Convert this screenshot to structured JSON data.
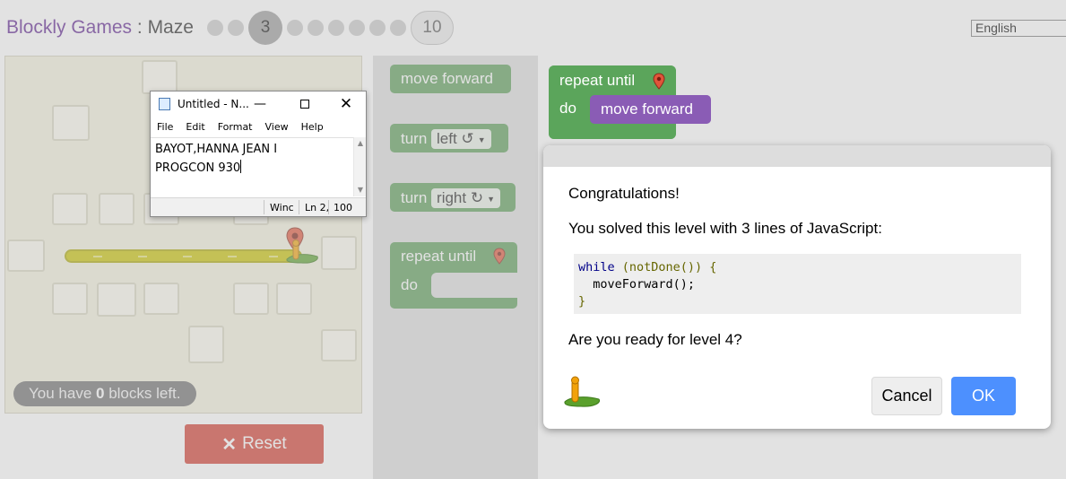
{
  "header": {
    "brand": "Blockly Games",
    "separator": " : ",
    "game": "Maze",
    "current_level": "3",
    "last_level": "10",
    "language": "English"
  },
  "maze": {
    "blocks_left_prefix": "You have ",
    "blocks_left_count": "0",
    "blocks_left_suffix": " blocks left.",
    "reset_label": "Reset",
    "reset_icon": "close-x-icon"
  },
  "toolbox": {
    "move_forward": "move forward",
    "turn_left_prefix": "turn",
    "turn_left_value": "left ↺",
    "turn_right_prefix": "turn",
    "turn_right_value": "right ↻",
    "repeat_until": "repeat until",
    "do": "do"
  },
  "workspace": {
    "repeat_until": "repeat until",
    "do": "do",
    "move_forward": "move forward"
  },
  "dialog": {
    "congrats": "Congratulations!",
    "solved": "You solved this level with 3 lines of JavaScript:",
    "code_keyword": "while",
    "code_line1_rest": " (notDone()) {",
    "code_line2": "  moveForward();",
    "code_line3": "}",
    "ready": "Are you ready for level 4?",
    "cancel": "Cancel",
    "ok": "OK"
  },
  "notepad": {
    "title": "Untitled - N...",
    "menu": [
      "File",
      "Edit",
      "Format",
      "View",
      "Help"
    ],
    "text_line1": "BAYOT,HANNA JEAN I",
    "text_line2": "PROGCON 930",
    "status_1": "Winc",
    "status_2": "Ln 2,",
    "status_3": "100"
  },
  "colors": {
    "brand": "#5c1f8f",
    "reset": "#d13b2e",
    "ok": "#4d90fe",
    "logic_block": "#5ba55b",
    "movement_block": "#8a5cb5"
  }
}
